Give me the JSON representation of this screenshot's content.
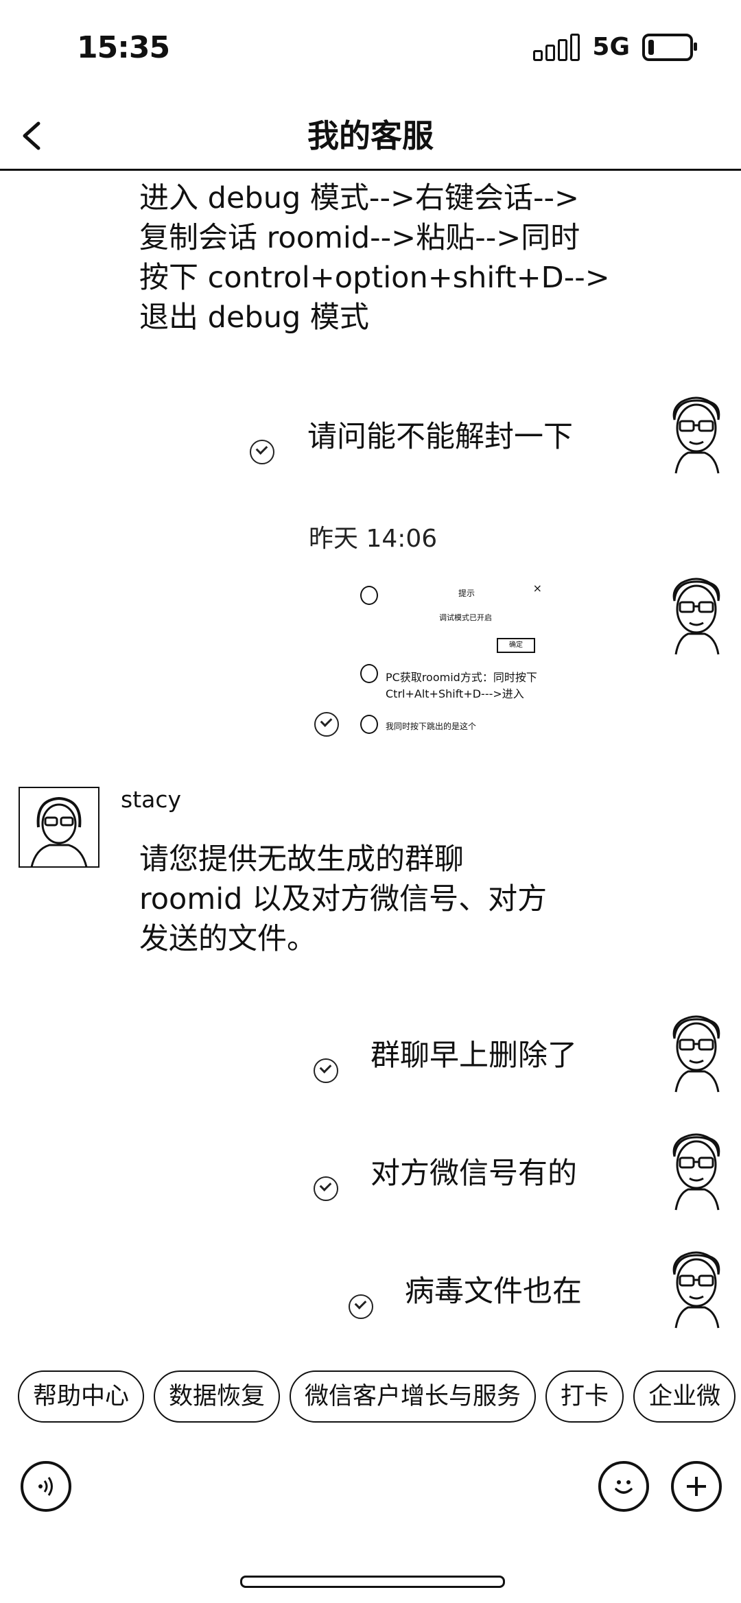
{
  "status_bar": {
    "time": "15:35",
    "network": "5G"
  },
  "nav": {
    "title": "我的客服"
  },
  "messages": {
    "m1": {
      "lines": [
        "进入 debug 模式-->右键会话-->",
        "复制会话 roomid-->粘贴-->同时",
        "按下 control+option+shift+D-->",
        "退出 debug 模式"
      ]
    },
    "m2": {
      "text": "请问能不能解封一下"
    },
    "timestamp": "昨天 14:06",
    "image_msg": {
      "dialog_title": "提示",
      "dialog_close": "×",
      "dialog_text": "调试模式已开启",
      "dialog_button": "确定",
      "line1": "PC获取roomid方式：同时按下",
      "line2": "Ctrl+Alt+Shift+D--->进入",
      "line3": "我同时按下跳出的是这个"
    },
    "agent": {
      "name": "stacy",
      "lines": [
        "请您提供无故生成的群聊",
        "roomid 以及对方微信号、对方",
        "发送的文件。"
      ]
    },
    "m4": {
      "text": "群聊早上删除了"
    },
    "m5": {
      "text": "对方微信号有的"
    },
    "m6": {
      "text": "病毒文件也在"
    }
  },
  "quick_replies": [
    "帮助中心",
    "数据恢复",
    "微信客户增长与服务",
    "打卡",
    "企业微"
  ],
  "icons": {
    "back": "chevron-left-icon",
    "voice": "voice-icon",
    "emoji": "emoji-icon",
    "plus": "plus-icon",
    "read": "check-circle-icon"
  }
}
